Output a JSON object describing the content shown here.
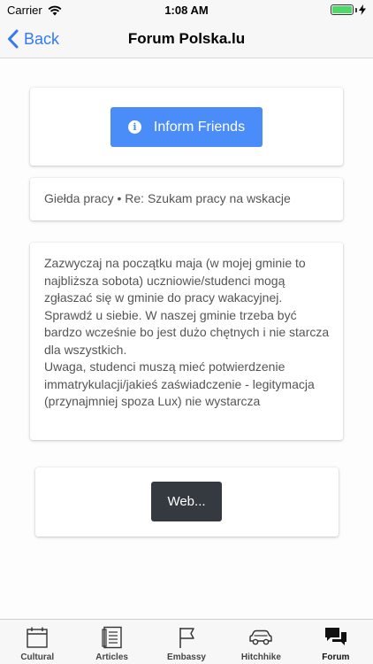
{
  "status": {
    "carrier": "Carrier",
    "time": "1:08 AM"
  },
  "nav": {
    "back_label": "Back",
    "title": "Forum Polska.lu"
  },
  "inform": {
    "button_label": "Inform Friends",
    "icon_glyph": "i"
  },
  "topic": {
    "text": "Giełda pracy • Re: Szukam pracy na wskacje"
  },
  "post": {
    "text": "Zazwyczaj na początku maja (w mojej gminie to najbliższa sobota) uczniowie/studenci mogą zgłaszać się w gminie do pracy wakacyjnej. Sprawdź u siebie. W naszej gminie trzeba być bardzo wcześnie bo jest dużo chętnych i nie starcza dla wszystkich.\nUwaga, studenci muszą mieć potwierdzenie immatrykulacji/jakieś zaświadczenie - legitymacja (przynajmniej spoza Lux) nie wystarcza"
  },
  "web": {
    "button_label": "Web..."
  },
  "tabs": [
    {
      "label": "Cultural",
      "icon": "calendar-icon"
    },
    {
      "label": "Articles",
      "icon": "articles-icon"
    },
    {
      "label": "Embassy",
      "icon": "flag-icon"
    },
    {
      "label": "Hitchhike",
      "icon": "car-icon"
    },
    {
      "label": "Forum",
      "icon": "forum-icon",
      "active": true
    }
  ],
  "colors": {
    "accent": "#3478f6",
    "inform_button": "#4b8df8",
    "web_button": "#343a40",
    "battery": "#4cd964"
  }
}
